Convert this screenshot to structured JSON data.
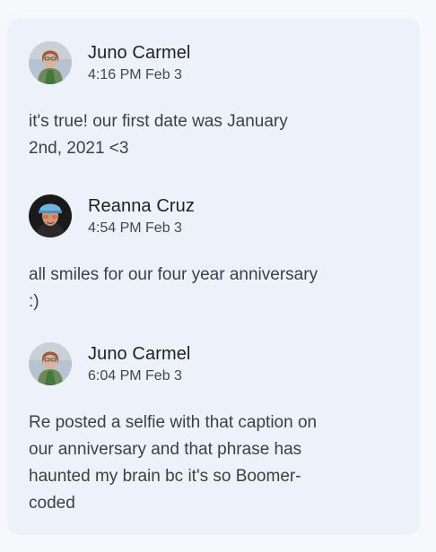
{
  "messages": [
    {
      "avatar_icon": "avatar-juno-icon",
      "name": "Juno Carmel",
      "time": "4:16 PM Feb 3",
      "text_lines": [
        "it's true! our first date was January",
        "2nd, 2021 <3"
      ]
    },
    {
      "avatar_icon": "avatar-reanna-icon",
      "name": "Reanna Cruz",
      "time": "4:54 PM Feb 3",
      "text_lines": [
        "all smiles for our four year anniversary",
        ":)"
      ]
    },
    {
      "avatar_icon": "avatar-juno-icon",
      "name": "Juno Carmel",
      "time": "6:04 PM Feb 3",
      "text_lines": [
        "Re posted a selfie with that caption on",
        "our anniversary and that phrase has",
        "haunted my brain bc it's so Boomer-",
        "coded"
      ]
    }
  ],
  "colors": {
    "card_background": "#edf1fa",
    "page_background": "#f7f8fb",
    "name_text": "#1f1f1f",
    "body_text": "#3c3f44"
  }
}
